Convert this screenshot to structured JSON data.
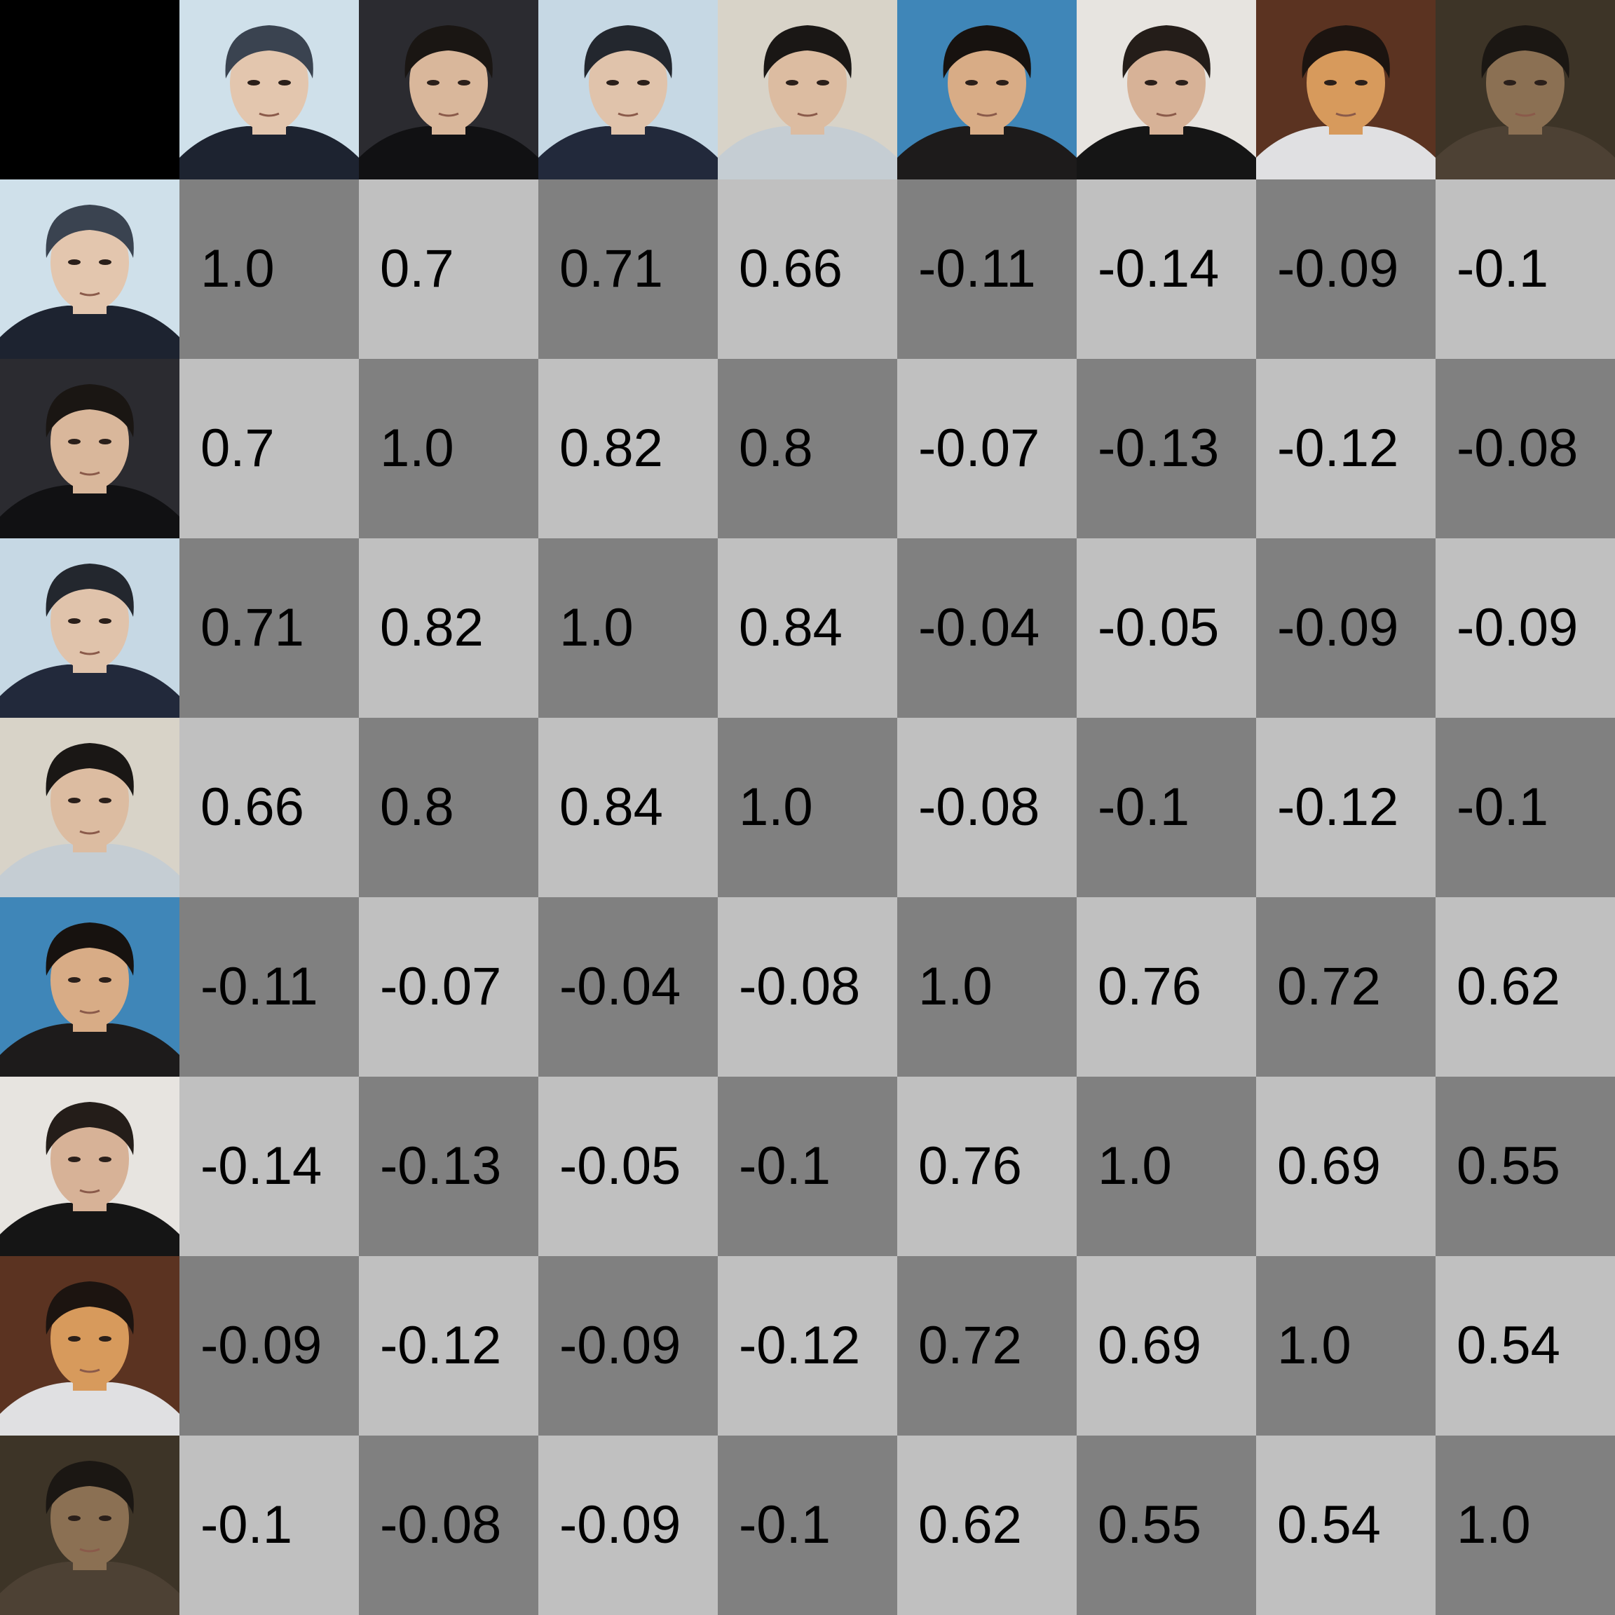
{
  "colors": {
    "corner": "#000000",
    "cell_dark": "#808080",
    "cell_light": "#c0c0c0",
    "text": "#000000"
  },
  "portraits": [
    {
      "icon": "face-portrait-icon",
      "subject": "person-a",
      "bg": "#cfe0ea",
      "hair": "#3a4350",
      "skin": "#e3c6ae",
      "shirt": "#1d2330"
    },
    {
      "icon": "face-portrait-icon",
      "subject": "person-a",
      "bg": "#2b2b30",
      "hair": "#1a1613",
      "skin": "#d9b79b",
      "shirt": "#111113"
    },
    {
      "icon": "face-portrait-icon",
      "subject": "person-a",
      "bg": "#c6d8e4",
      "hair": "#23272e",
      "skin": "#e0c3ab",
      "shirt": "#22293b"
    },
    {
      "icon": "face-portrait-icon",
      "subject": "person-a",
      "bg": "#d8d3c8",
      "hair": "#1a1715",
      "skin": "#dcbca1",
      "shirt": "#c5cdd3"
    },
    {
      "icon": "face-portrait-icon",
      "subject": "person-b",
      "bg": "#3f86b8",
      "hair": "#17120f",
      "skin": "#d8ac86",
      "shirt": "#1d1b1b"
    },
    {
      "icon": "face-portrait-icon",
      "subject": "person-b",
      "bg": "#e7e4e0",
      "hair": "#241d19",
      "skin": "#d7b297",
      "shirt": "#151515"
    },
    {
      "icon": "face-portrait-icon",
      "subject": "person-b",
      "bg": "#5b3321",
      "hair": "#1c1410",
      "skin": "#d79a5c",
      "shirt": "#e0e0e2"
    },
    {
      "icon": "face-portrait-icon",
      "subject": "person-b",
      "bg": "#3d3427",
      "hair": "#1b1713",
      "skin": "#8b7053",
      "shirt": "#4d4134"
    }
  ],
  "matrix": [
    [
      "1.0",
      "0.7",
      "0.71",
      "0.66",
      "-0.11",
      "-0.14",
      "-0.09",
      "-0.1"
    ],
    [
      "0.7",
      "1.0",
      "0.82",
      "0.8",
      "-0.07",
      "-0.13",
      "-0.12",
      "-0.08"
    ],
    [
      "0.71",
      "0.82",
      "1.0",
      "0.84",
      "-0.04",
      "-0.05",
      "-0.09",
      "-0.09"
    ],
    [
      "0.66",
      "0.8",
      "0.84",
      "1.0",
      "-0.08",
      "-0.1",
      "-0.12",
      "-0.1"
    ],
    [
      "-0.11",
      "-0.07",
      "-0.04",
      "-0.08",
      "1.0",
      "0.76",
      "0.72",
      "0.62"
    ],
    [
      "-0.14",
      "-0.13",
      "-0.05",
      "-0.1",
      "0.76",
      "1.0",
      "0.69",
      "0.55"
    ],
    [
      "-0.09",
      "-0.12",
      "-0.09",
      "-0.12",
      "0.72",
      "0.69",
      "1.0",
      "0.54"
    ],
    [
      "-0.1",
      "-0.08",
      "-0.09",
      "-0.1",
      "0.62",
      "0.55",
      "0.54",
      "1.0"
    ]
  ]
}
